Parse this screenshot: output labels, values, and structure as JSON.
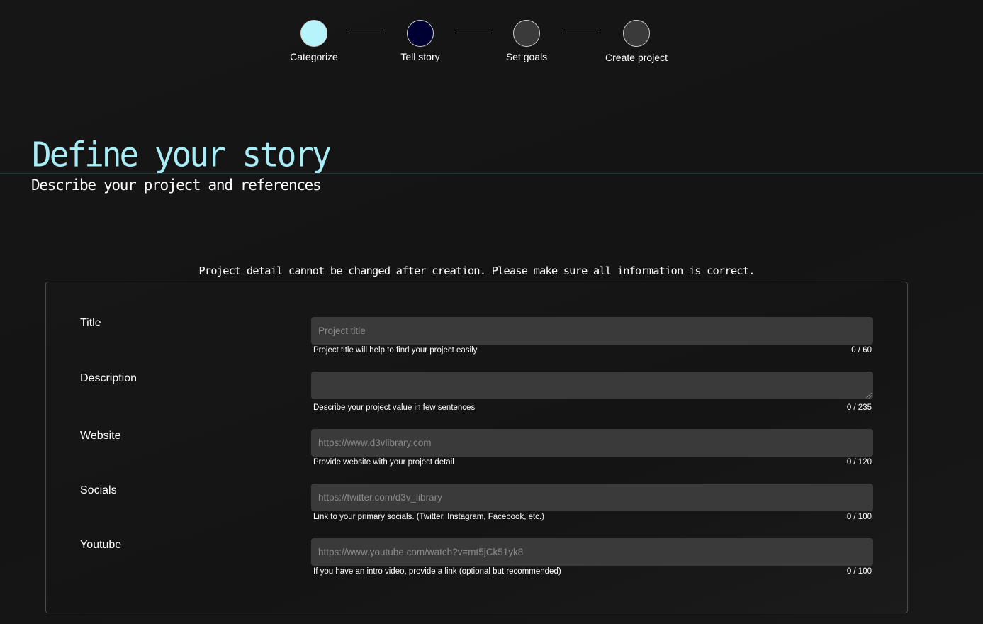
{
  "stepper": {
    "steps": [
      {
        "label": "Categorize",
        "state": "done",
        "color": "#b6f4fb"
      },
      {
        "label": "Tell story",
        "state": "current",
        "color": "#000033"
      },
      {
        "label": "Set goals",
        "state": "upcoming",
        "color": "#3a3a3a"
      },
      {
        "label": "Create project",
        "state": "upcoming",
        "color": "#3a3a3a"
      }
    ]
  },
  "header": {
    "title": "Define your story",
    "subtitle": "Describe your project and references"
  },
  "notice": "Project detail cannot be changed after creation. Please make sure all information is correct.",
  "form": {
    "fields": [
      {
        "label": "Title",
        "value": "",
        "placeholder": "Project title",
        "helper": "Project title will help to find your project easily",
        "counter": "0 / 60"
      },
      {
        "label": "Description",
        "value": "",
        "placeholder": "",
        "helper": "Describe your project value in few sentences",
        "counter": "0 / 235"
      },
      {
        "label": "Website",
        "value": "",
        "placeholder": "https://www.d3vlibrary.com",
        "helper": "Provide website with your project detail",
        "counter": "0 / 120"
      },
      {
        "label": "Socials",
        "value": "",
        "placeholder": "https://twitter.com/d3v_library",
        "helper": "Link to your primary socials. (Twitter, Instagram, Facebook, etc.)",
        "counter": "0 / 100"
      },
      {
        "label": "Youtube",
        "value": "",
        "placeholder": "https://www.youtube.com/watch?v=mt5jCk51yk8",
        "helper": "If you have an intro video, provide a link (optional but recommended)",
        "counter": "0 / 100"
      }
    ]
  },
  "colors": {
    "accent": "#a8edf6",
    "background": "#141414",
    "input_bg": "#3a3a3a"
  }
}
